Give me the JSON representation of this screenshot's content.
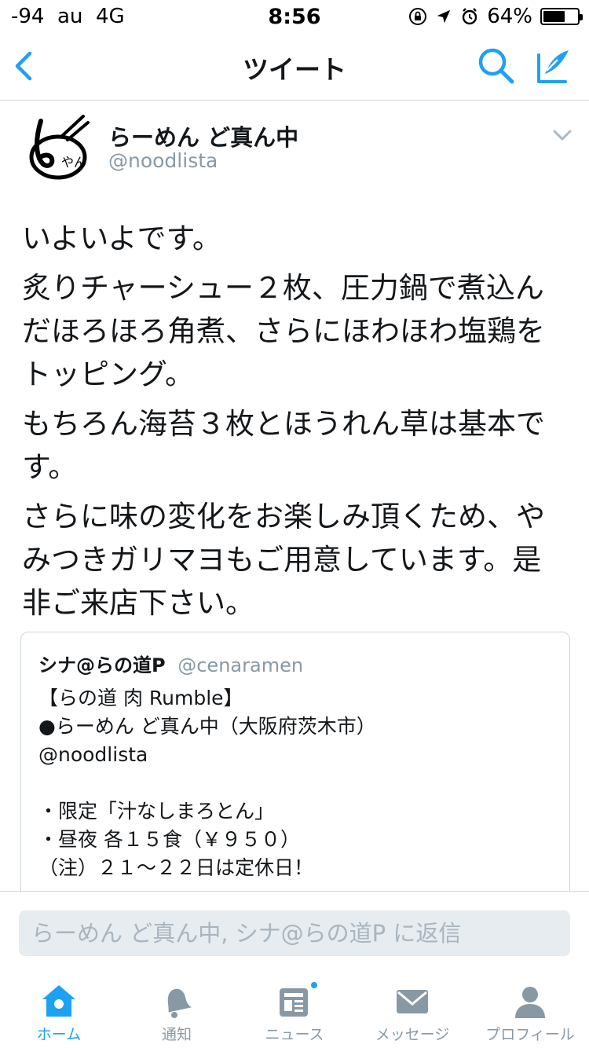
{
  "status_bar": {
    "signal": "-94",
    "carrier": "au",
    "network": "4G",
    "time": "8:56",
    "battery_text": "64%",
    "battery_level": 0.64
  },
  "nav": {
    "title": "ツイート"
  },
  "tweet": {
    "author_name": "らーめん ど真ん中",
    "author_handle": "@noodlista",
    "paragraphs": [
      "いよいよです。",
      "炙りチャーシュー２枚、圧力鍋で煮込んだほろほろ角煮、さらにほわほわ塩鶏をトッピング。",
      "もちろん海苔３枚とほうれん草は基本です。",
      "さらに味の変化をお楽しみ頂くため、やみつきガリマヨもご用意しています。是非ご来店下さい。"
    ]
  },
  "quote": {
    "name": "シナ@らの道P",
    "handle": "@cenaramen",
    "lines": [
      "【らの道 肉 Rumble】",
      "●らーめん ど真ん中（大阪府茨木市）",
      "@noodlista",
      "",
      "・限定「汁なしまろとん」",
      "・昼夜 各１５食（￥９５０）",
      "（注）２１～２２日は定休日！"
    ]
  },
  "reply": {
    "placeholder": "らーめん ど真ん中, シナ@らの道P に返信"
  },
  "tabs": [
    {
      "label": "ホーム",
      "icon": "home-icon",
      "active": true
    },
    {
      "label": "通知",
      "icon": "bell-icon",
      "active": false
    },
    {
      "label": "ニュース",
      "icon": "news-icon",
      "active": false,
      "badge": true
    },
    {
      "label": "メッセージ",
      "icon": "envelope-icon",
      "active": false
    },
    {
      "label": "プロフィール",
      "icon": "person-icon",
      "active": false
    }
  ],
  "colors": {
    "accent": "#1da1f2",
    "text": "#14171a",
    "muted": "#8899a6",
    "border": "#ccd6dd"
  }
}
